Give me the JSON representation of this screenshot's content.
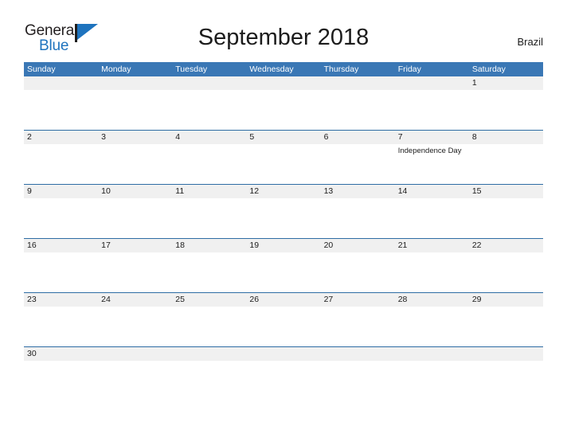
{
  "brand": {
    "name_part1": "General",
    "name_part2": "Blue",
    "flag_icon": "triangle-flag-icon",
    "color_dark": "#231f20",
    "color_blue": "#1e73be"
  },
  "header": {
    "title": "September 2018",
    "region": "Brazil"
  },
  "theme": {
    "header_band": "#3a77b5",
    "row_divider": "#2e6da4",
    "daynum_band": "#f0f0f0",
    "page_background": "#ffffff",
    "text": "#1c1c1c"
  },
  "calendar": {
    "month": "September",
    "year": "2018",
    "weekday_headers": [
      "Sunday",
      "Monday",
      "Tuesday",
      "Wednesday",
      "Thursday",
      "Friday",
      "Saturday"
    ],
    "weeks": [
      {
        "days": [
          {
            "number": "",
            "event": ""
          },
          {
            "number": "",
            "event": ""
          },
          {
            "number": "",
            "event": ""
          },
          {
            "number": "",
            "event": ""
          },
          {
            "number": "",
            "event": ""
          },
          {
            "number": "",
            "event": ""
          },
          {
            "number": "1",
            "event": ""
          }
        ]
      },
      {
        "days": [
          {
            "number": "2",
            "event": ""
          },
          {
            "number": "3",
            "event": ""
          },
          {
            "number": "4",
            "event": ""
          },
          {
            "number": "5",
            "event": ""
          },
          {
            "number": "6",
            "event": ""
          },
          {
            "number": "7",
            "event": "Independence Day"
          },
          {
            "number": "8",
            "event": ""
          }
        ]
      },
      {
        "days": [
          {
            "number": "9",
            "event": ""
          },
          {
            "number": "10",
            "event": ""
          },
          {
            "number": "11",
            "event": ""
          },
          {
            "number": "12",
            "event": ""
          },
          {
            "number": "13",
            "event": ""
          },
          {
            "number": "14",
            "event": ""
          },
          {
            "number": "15",
            "event": ""
          }
        ]
      },
      {
        "days": [
          {
            "number": "16",
            "event": ""
          },
          {
            "number": "17",
            "event": ""
          },
          {
            "number": "18",
            "event": ""
          },
          {
            "number": "19",
            "event": ""
          },
          {
            "number": "20",
            "event": ""
          },
          {
            "number": "21",
            "event": ""
          },
          {
            "number": "22",
            "event": ""
          }
        ]
      },
      {
        "days": [
          {
            "number": "23",
            "event": ""
          },
          {
            "number": "24",
            "event": ""
          },
          {
            "number": "25",
            "event": ""
          },
          {
            "number": "26",
            "event": ""
          },
          {
            "number": "27",
            "event": ""
          },
          {
            "number": "28",
            "event": ""
          },
          {
            "number": "29",
            "event": ""
          }
        ]
      },
      {
        "days": [
          {
            "number": "30",
            "event": ""
          },
          {
            "number": "",
            "event": ""
          },
          {
            "number": "",
            "event": ""
          },
          {
            "number": "",
            "event": ""
          },
          {
            "number": "",
            "event": ""
          },
          {
            "number": "",
            "event": ""
          },
          {
            "number": "",
            "event": ""
          }
        ]
      }
    ]
  }
}
